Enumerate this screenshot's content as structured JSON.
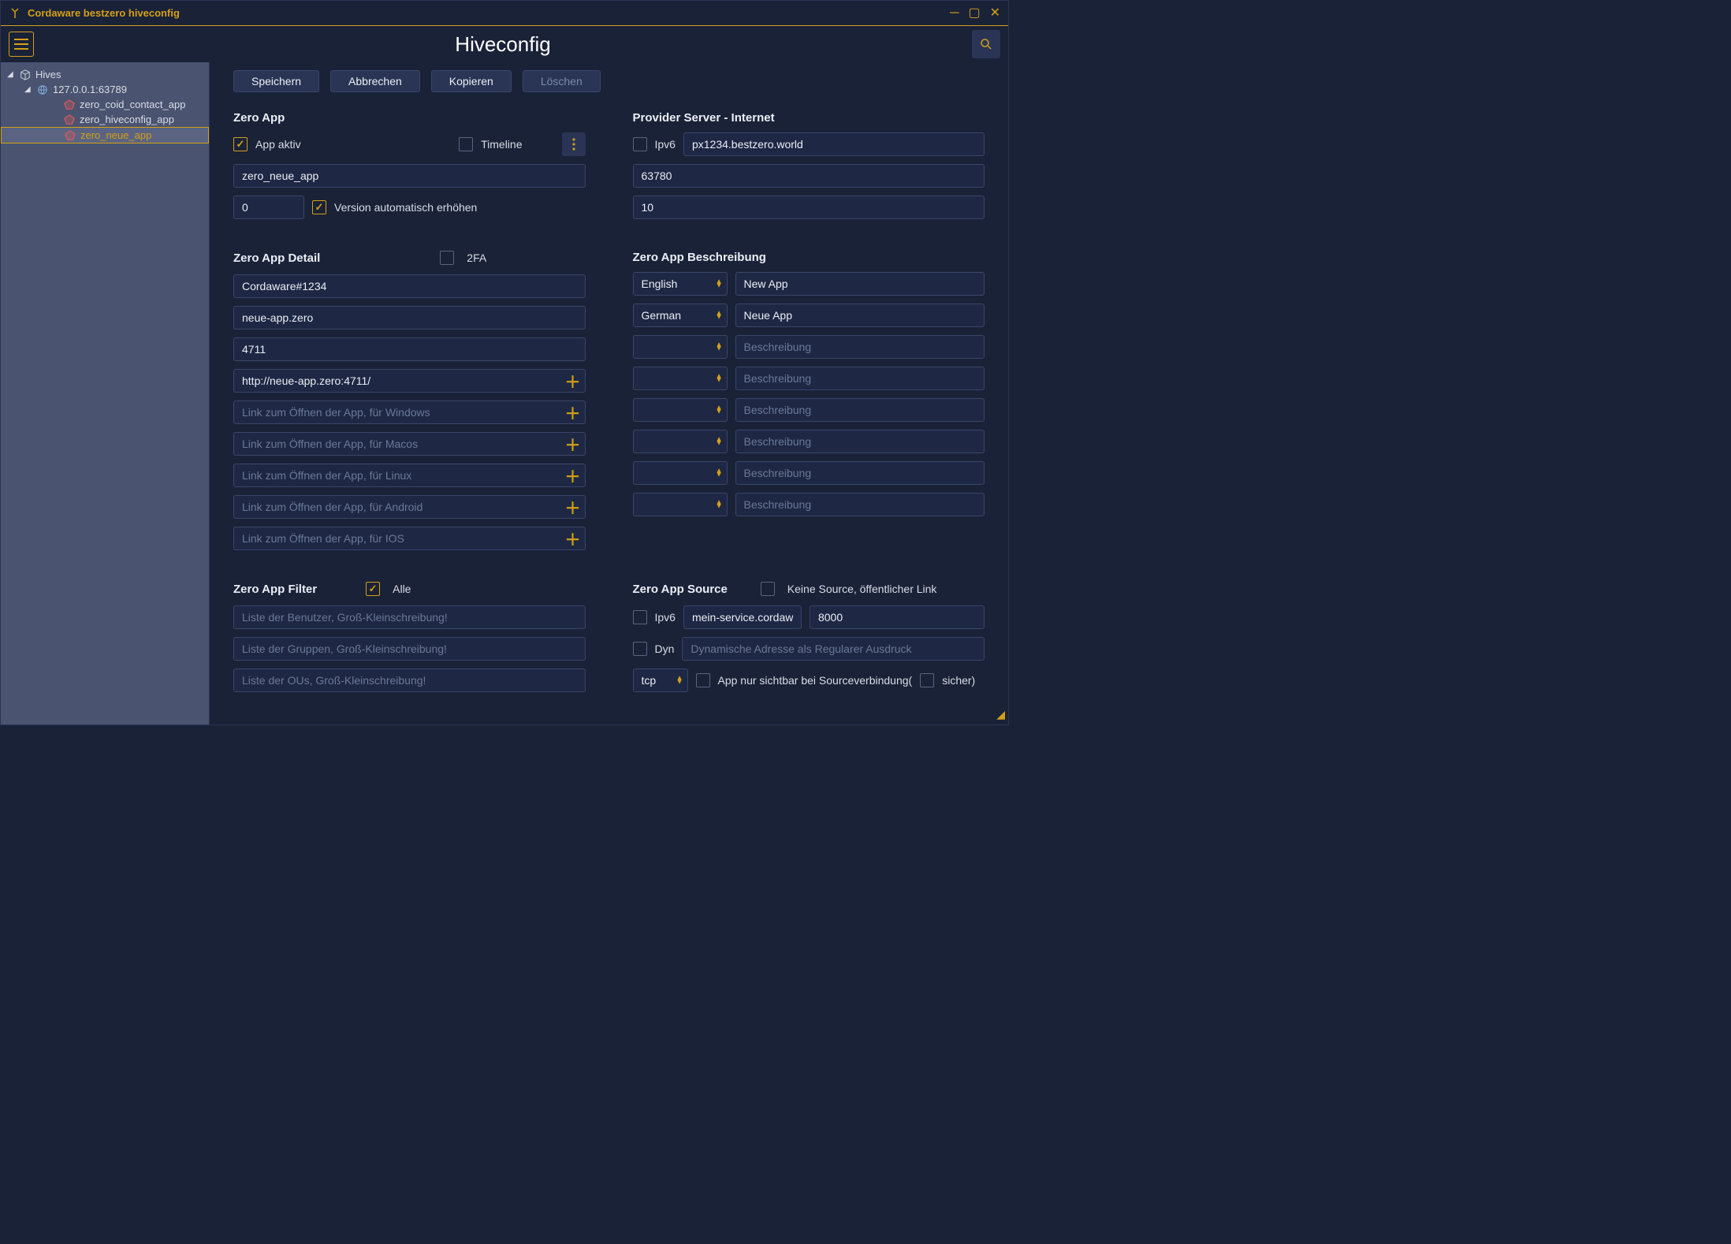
{
  "titlebar": {
    "title": "Cordaware bestzero hiveconfig"
  },
  "page": {
    "heading": "Hiveconfig"
  },
  "sidebar": {
    "root": "Hives",
    "host": "127.0.0.1:63789",
    "apps": [
      "zero_coid_contact_app",
      "zero_hiveconfig_app",
      "zero_neue_app"
    ],
    "selected": "zero_neue_app"
  },
  "actions": {
    "save": "Speichern",
    "cancel": "Abbrechen",
    "copy": "Kopieren",
    "delete": "Löschen"
  },
  "zero_app": {
    "title": "Zero App",
    "active_label": "App aktiv",
    "timeline_label": "Timeline",
    "name": "zero_neue_app",
    "version": "0",
    "auto_version_label": "Version automatisch erhöhen"
  },
  "provider": {
    "title": "Provider Server - Internet",
    "ipv6_label": "Ipv6",
    "host": "px1234.bestzero.world",
    "port": "63780",
    "retries": "10"
  },
  "detail": {
    "title": "Zero App Detail",
    "twofa_label": "2FA",
    "d0": "Cordaware#1234",
    "d1": "neue-app.zero",
    "d2": "4711",
    "url": "http://neue-app.zero:4711/",
    "pl_win": "Link zum Öffnen der App, für Windows",
    "pl_mac": "Link zum Öffnen der App, für Macos",
    "pl_linux": "Link zum Öffnen der App, für Linux",
    "pl_android": "Link zum Öffnen der App, für Android",
    "pl_ios": "Link zum Öffnen der App, für IOS"
  },
  "desc": {
    "title": "Zero App Beschreibung",
    "rows": [
      {
        "lang": "English",
        "text": "New App"
      },
      {
        "lang": "German",
        "text": "Neue App"
      },
      {
        "lang": "",
        "text": ""
      },
      {
        "lang": "",
        "text": ""
      },
      {
        "lang": "",
        "text": ""
      },
      {
        "lang": "",
        "text": ""
      },
      {
        "lang": "",
        "text": ""
      },
      {
        "lang": "",
        "text": ""
      }
    ],
    "placeholder": "Beschreibung"
  },
  "filter": {
    "title": "Zero App Filter",
    "all_label": "Alle",
    "pl_users": "Liste der Benutzer, Groß-Kleinschreibung!",
    "pl_groups": "Liste der Gruppen, Groß-Kleinschreibung!",
    "pl_ous": "Liste der OUs, Groß-Kleinschreibung!"
  },
  "source": {
    "title": "Zero App Source",
    "nosource_label": "Keine Source, öffentlicher Link",
    "ipv6_label": "Ipv6",
    "host": "mein-service.cordawa",
    "port": "8000",
    "dyn_label": "Dyn",
    "dyn_placeholder": "Dynamische Adresse als Regularer Ausdruck",
    "protocol": "tcp",
    "visibility_prefix": "App nur sichtbar bei Sourceverbindung(",
    "safe_label": "sicher)"
  }
}
